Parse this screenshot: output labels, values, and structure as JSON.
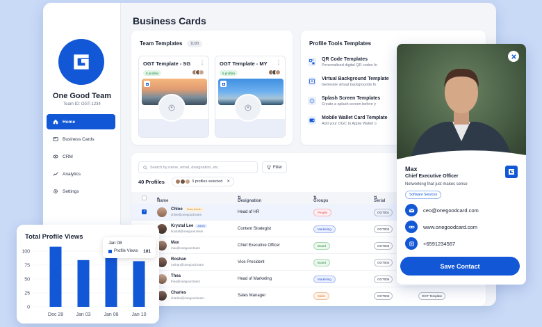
{
  "window": {
    "dot_colors": [
      "#ff5f57",
      "#febc2e",
      "#28c840"
    ]
  },
  "sidebar": {
    "org_name": "One Good Team",
    "org_id": "Team ID: OGT-1234",
    "items": [
      {
        "label": "Home",
        "icon": "home-icon",
        "active": true
      },
      {
        "label": "Business Cards",
        "icon": "card-icon",
        "active": false
      },
      {
        "label": "CRM",
        "icon": "eye-icon",
        "active": false
      },
      {
        "label": "Analytics",
        "icon": "chart-line-icon",
        "active": false
      },
      {
        "label": "Settings",
        "icon": "gear-icon",
        "active": false
      }
    ]
  },
  "page_title": "Business Cards",
  "team_templates": {
    "title": "Team Templates",
    "count": "11/20",
    "cards": [
      {
        "title": "OGT Template - SG",
        "badge": "8 profiles"
      },
      {
        "title": "OGT Template - MY",
        "badge": "6 profiles"
      }
    ]
  },
  "profile_tools": {
    "title": "Profile Tools Templates",
    "items": [
      {
        "name": "QR Code Templates",
        "desc": "Personalised digital QR codes fo",
        "icon": "qr-icon"
      },
      {
        "name": "Virtual Background Template",
        "desc": "Generate virtual backgrounds fo",
        "icon": "background-icon"
      },
      {
        "name": "Splash Screen Templates",
        "desc": "Create a splash screen before y",
        "icon": "splash-icon"
      },
      {
        "name": "Mobile Wallet Card Template",
        "desc": "Add your OGC to Apple Wallet o",
        "icon": "wallet-icon"
      }
    ]
  },
  "profiles": {
    "search_placeholder": "Search by name, email, designation, etc.",
    "filter_label": "Filter",
    "count_label": "40 Profiles",
    "selected_label": "3 profiles selected",
    "columns": [
      "Name",
      "Designation",
      "Groups",
      "Serial"
    ],
    "rows": [
      {
        "name": "Chloe",
        "tag": "Team Admin",
        "email": "chloe@onegood.team",
        "designation": "Head of HR",
        "group": "People",
        "serial": "OGT001",
        "template": "",
        "selected": true
      },
      {
        "name": "Krystal Lee",
        "tag": "Admin",
        "email": "krystal@onegood.team",
        "designation": "Content Strategist",
        "group": "Marketing",
        "serial": "OGT002",
        "template": "",
        "selected": false
      },
      {
        "name": "Max",
        "tag": "",
        "email": "max@onegood.team",
        "designation": "Chief Executive Officer",
        "group": "Board",
        "serial": "OGT003",
        "template": "",
        "selected": false
      },
      {
        "name": "Roshan",
        "tag": "",
        "email": "roshan@onegood.team",
        "designation": "Vice President",
        "group": "Board",
        "serial": "OGT004",
        "template": "",
        "selected": false
      },
      {
        "name": "Thea",
        "tag": "",
        "email": "thea@onegood.team",
        "designation": "Head of Marketing",
        "group": "Marketing",
        "serial": "OGT005",
        "template": "",
        "selected": false
      },
      {
        "name": "Charles",
        "tag": "",
        "email": "charles@onegood.team",
        "designation": "Sales Manager",
        "group": "Sales",
        "serial": "OGT006",
        "template": "OGT Template",
        "selected": false
      }
    ]
  },
  "views": {
    "title": "Total Profile Views",
    "tooltip": {
      "date": "Jan 08",
      "series": "Profile Views",
      "value": "101"
    }
  },
  "chart_data": {
    "type": "bar",
    "title": "Total Profile Views",
    "categories": [
      "Dec 28",
      "Jan 03",
      "Jan 08",
      "Jan 10"
    ],
    "values": [
      108,
      84,
      101,
      82
    ],
    "yticks": [
      0,
      25,
      50,
      75,
      100
    ],
    "ylim": [
      0,
      110
    ],
    "bar_color": "#1257d6"
  },
  "contact": {
    "name": "Max",
    "role": "Chief Executive Officer",
    "tagline": "Networking that just makes sense",
    "chip": "Software Services",
    "email": "ceo@onegoodcard.com",
    "website": "www.onegoodcard.com",
    "phone": "+6591234567",
    "save_label": "Save Contact"
  }
}
